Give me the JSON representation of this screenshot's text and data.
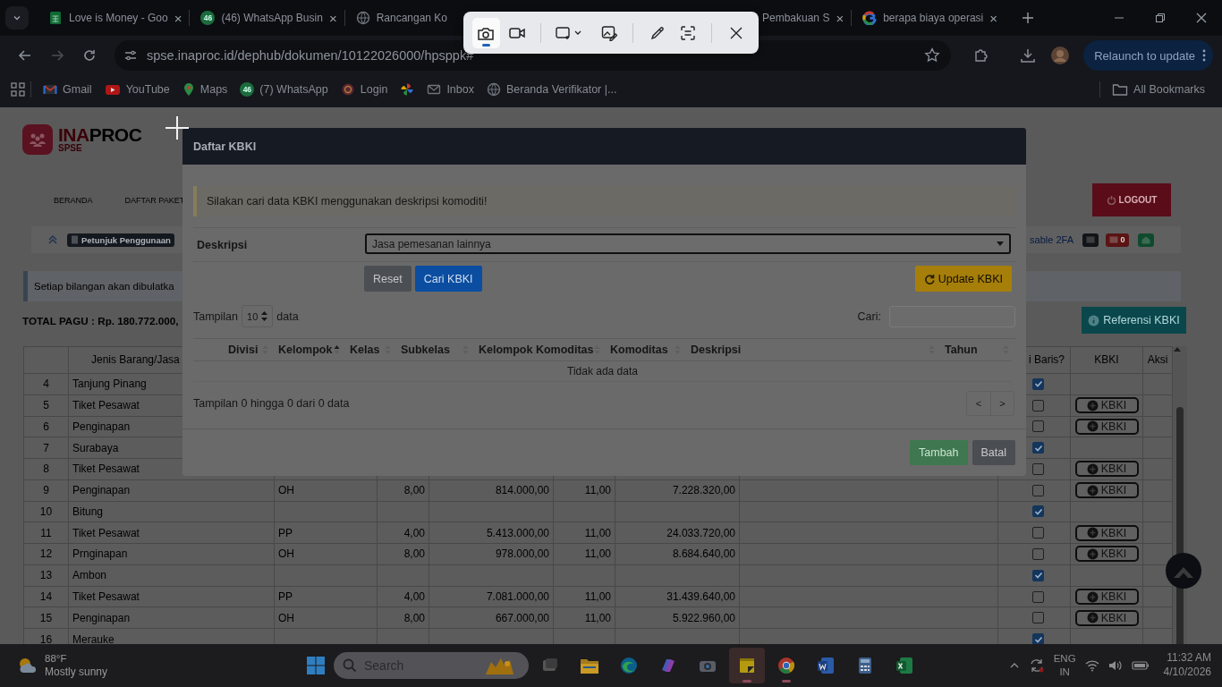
{
  "browser": {
    "tabs": [
      {
        "kind": "sheets",
        "title": "Love is Money - Goo",
        "close": "×"
      },
      {
        "kind": "whatsapp",
        "badge": "46",
        "title": "(46) WhatsApp Busin",
        "close": "×"
      },
      {
        "kind": "globe",
        "title": "Rancangan Ko"
      },
      {
        "kind": "none",
        "title": "Pembakuan S",
        "close": "×"
      },
      {
        "kind": "google",
        "title": "berapa biaya operasi",
        "close": "×"
      }
    ],
    "url": "spse.inaproc.id/dephub/dokumen/10122026000/hpsppk#",
    "relaunch": "Relaunch to update",
    "bookmarks": [
      {
        "kind": "gmail",
        "label": "Gmail"
      },
      {
        "kind": "youtube",
        "label": "YouTube"
      },
      {
        "kind": "maps",
        "label": "Maps"
      },
      {
        "kind": "whatsapp",
        "badge": "46",
        "label": "(7) WhatsApp"
      },
      {
        "kind": "login",
        "label": "Login"
      },
      {
        "kind": "photos"
      },
      {
        "kind": "mail",
        "label": "Inbox"
      },
      {
        "kind": "globe",
        "label": "Beranda Verifikator |..."
      }
    ],
    "all_bookmarks": "All Bookmarks"
  },
  "snip_toolbar": {
    "modes": [
      {
        "kind": "photo",
        "selected": true
      },
      {
        "kind": "video",
        "selected": false
      }
    ]
  },
  "page": {
    "logo": {
      "accent": "INA",
      "rest": "PROC",
      "sub": "SPSE"
    },
    "nav": [
      "BERANDA",
      "DAFTAR PAKET"
    ],
    "logout": "LOGOUT",
    "guide": "Petunjuk Penggunaan",
    "twofa_link": "sable 2FA",
    "mail_count": "0",
    "notice": "Setiap bilangan akan dibulatka",
    "total": "TOTAL PAGU : Rp. 180.772.000,",
    "reference_button": "Referensi KBKI",
    "table": {
      "columns": {
        "item": "Jenis Barang/Jasa",
        "column_9": "i Baris?",
        "kbki": "KBKI",
        "action": "Aksi"
      },
      "rows": [
        {
          "no": "4",
          "item": "Tanjung Pinang",
          "checked": true
        },
        {
          "no": "5",
          "item": "Tiket Pesawat",
          "checked": false,
          "kbki": "KBKI"
        },
        {
          "no": "6",
          "item": "Penginapan",
          "checked": false,
          "kbki": "KBKI"
        },
        {
          "no": "7",
          "item": "Surabaya",
          "checked": true
        },
        {
          "no": "8",
          "item": "Tiket Pesawat",
          "checked": false,
          "kbki": "KBKI"
        },
        {
          "no": "9",
          "item": "Penginapan",
          "unit": "OH",
          "qty": "8,00",
          "price": "814.000,00",
          "tax": "11,00",
          "total": "7.228.320,00",
          "checked": false,
          "kbki": "KBKI"
        },
        {
          "no": "10",
          "item": "Bitung",
          "checked": true
        },
        {
          "no": "11",
          "item": "Tiket Pesawat",
          "unit": "PP",
          "qty": "4,00",
          "price": "5.413.000,00",
          "tax": "11,00",
          "total": "24.033.720,00",
          "checked": false,
          "kbki": "KBKI"
        },
        {
          "no": "12",
          "item": "Prnginapan",
          "unit": "OH",
          "qty": "8,00",
          "price": "978.000,00",
          "tax": "11,00",
          "total": "8.684.640,00",
          "checked": false,
          "kbki": "KBKI"
        },
        {
          "no": "13",
          "item": "Ambon",
          "checked": true
        },
        {
          "no": "14",
          "item": "Tiket Pesawat",
          "unit": "PP",
          "qty": "4,00",
          "price": "7.081.000,00",
          "tax": "11,00",
          "total": "31.439.640,00",
          "checked": false,
          "kbki": "KBKI"
        },
        {
          "no": "15",
          "item": "Penginapan",
          "unit": "OH",
          "qty": "8,00",
          "price": "667.000,00",
          "tax": "11,00",
          "total": "5.922.960,00",
          "checked": false,
          "kbki": "KBKI"
        },
        {
          "no": "16",
          "item": "Merauke",
          "checked": true
        }
      ]
    }
  },
  "modal": {
    "title": "Daftar KBKI",
    "notice": "Silakan cari data KBKI menggunakan deskripsi komoditi!",
    "field_label": "Deskripsi",
    "field_value": "Jasa pemesanan lainnya",
    "buttons": {
      "reset": "Reset",
      "search": "Cari KBKI",
      "update": "Update KBKI",
      "add": "Tambah",
      "cancel": "Batal"
    },
    "length_label": "Tampilan",
    "length_value": "10",
    "length_suffix": "data",
    "search_label": "Cari:",
    "table": {
      "columns": [
        {
          "label": "Divisi",
          "sorted": false
        },
        {
          "label": "Kelompok",
          "sorted": true
        },
        {
          "label": "Kelas",
          "sorted": false
        },
        {
          "label": "Subkelas",
          "sorted": false
        },
        {
          "label": "Kelompok Komoditas",
          "sorted": false
        },
        {
          "label": "Komoditas",
          "sorted": false
        },
        {
          "label": "Deskripsi",
          "sorted": false
        },
        {
          "label": "Tahun",
          "sorted": false
        }
      ],
      "empty": "Tidak ada data"
    },
    "info": "Tampilan 0 hingga 0 dari 0 data",
    "pager": [
      "<",
      ">"
    ]
  },
  "taskbar": {
    "weather": {
      "temp": "88°F",
      "condition": "Mostly sunny"
    },
    "search": "Search",
    "apps": [
      {
        "kind": "taskview",
        "running": false
      },
      {
        "kind": "explorer",
        "running": false
      },
      {
        "kind": "edge",
        "running": false
      },
      {
        "kind": "copilot",
        "running": false
      },
      {
        "kind": "camera",
        "running": false
      },
      {
        "kind": "sticky",
        "running": true
      },
      {
        "kind": "chrome",
        "running": true
      },
      {
        "kind": "word",
        "running": false
      },
      {
        "kind": "calculator",
        "running": false
      },
      {
        "kind": "excel",
        "running": false
      }
    ],
    "language": "ENG",
    "region": "IN",
    "time": "11:32 AM",
    "date": "4/10/2026"
  }
}
